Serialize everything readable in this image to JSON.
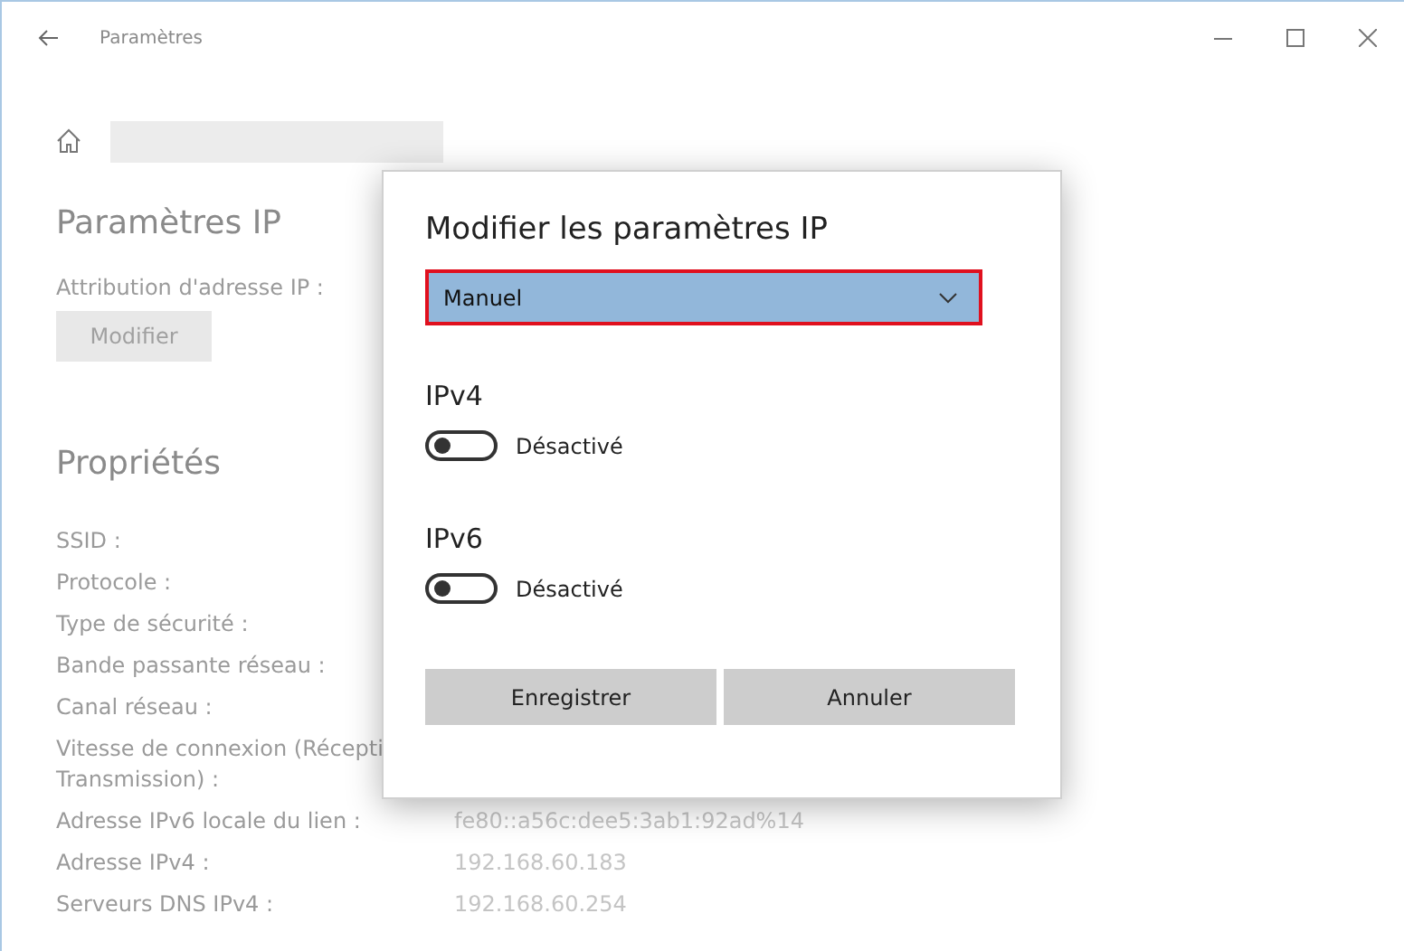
{
  "window": {
    "title": "Paramètres"
  },
  "ip_settings": {
    "title": "Paramètres IP",
    "assignment_label": "Attribution d'adresse IP :",
    "edit_button": "Modifier"
  },
  "properties": {
    "title": "Propriétés",
    "rows": [
      {
        "label": "SSID :"
      },
      {
        "label": "Protocole :"
      },
      {
        "label": "Type de sécurité :"
      },
      {
        "label": "Bande passante réseau :"
      },
      {
        "label": "Canal réseau :"
      },
      {
        "label": "Vitesse de connexion (Récepti\nTransmission) :"
      },
      {
        "label": "Adresse IPv6 locale du lien :",
        "value": "fe80::a56c:dee5:3ab1:92ad%14"
      },
      {
        "label": "Adresse IPv4 :",
        "value": "192.168.60.183"
      },
      {
        "label": "Serveurs DNS IPv4 :",
        "value": "192.168.60.254"
      }
    ]
  },
  "dialog": {
    "title": "Modifier les paramètres IP",
    "dropdown": {
      "value": "Manuel"
    },
    "sections": [
      {
        "title": "IPv4",
        "on": false,
        "state_label": "Désactivé"
      },
      {
        "title": "IPv6",
        "on": false,
        "state_label": "Désactivé"
      }
    ],
    "buttons": [
      "Enregistrer",
      "Annuler"
    ]
  }
}
